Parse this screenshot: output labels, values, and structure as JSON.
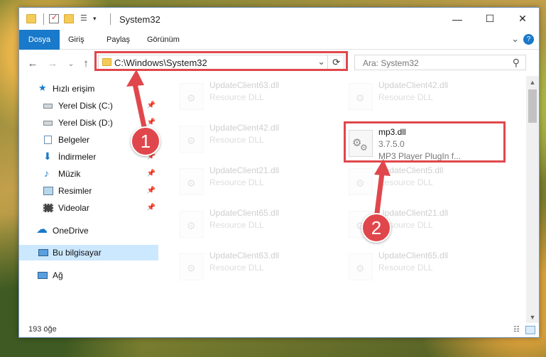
{
  "window": {
    "title": "System32",
    "quick_access_toolbar": [
      "folder-icon",
      "properties-icon",
      "new-folder-icon",
      "customize-icon",
      "dropdown-icon"
    ],
    "controls": {
      "minimize": "—",
      "maximize": "☐",
      "close": "✕"
    }
  },
  "ribbon": {
    "tabs": [
      "Dosya",
      "Giriş",
      "Paylaş",
      "Görünüm"
    ],
    "active_tab": "Dosya",
    "collapse_icon": "⌄",
    "help_icon": "?"
  },
  "navigation": {
    "back": "←",
    "forward": "→",
    "recent": "⌄",
    "up": "↑",
    "address": "C:\\Windows\\System32",
    "address_dropdown": "⌄",
    "refresh": "⟳",
    "search_placeholder": "Ara: System32",
    "search_icon": "⚲"
  },
  "sidebar": {
    "quick_access": "Hızlı erişim",
    "items": [
      {
        "label": "Yerel Disk (C:)",
        "icon": "drive-icon",
        "pinned": true
      },
      {
        "label": "Yerel Disk (D:)",
        "icon": "drive-icon",
        "pinned": true
      },
      {
        "label": "Belgeler",
        "icon": "documents-icon",
        "pinned": true
      },
      {
        "label": "İndirmeler",
        "icon": "downloads-icon",
        "pinned": true
      },
      {
        "label": "Müzik",
        "icon": "music-icon",
        "pinned": true
      },
      {
        "label": "Resimler",
        "icon": "pictures-icon",
        "pinned": true
      },
      {
        "label": "Videolar",
        "icon": "videos-icon",
        "pinned": true
      }
    ],
    "onedrive": "OneDrive",
    "this_pc": "Bu bilgisayar",
    "network": "Ağ",
    "pin_glyph": "📌"
  },
  "files": {
    "left_column": [
      {
        "name": "UpdateClient63.dll",
        "desc": "Resource DLL"
      },
      {
        "name": "UpdateClient42.dll",
        "desc": "Resource DLL"
      },
      {
        "name": "UpdateClient21.dll",
        "desc": "Resource DLL"
      },
      {
        "name": "UpdateClient65.dll",
        "desc": "Resource DLL"
      },
      {
        "name": "UpdateClient63.dll",
        "desc": "Resource DLL"
      }
    ],
    "right_column": [
      {
        "name": "UpdateClient42.dll",
        "desc": "Resource DLL"
      },
      {
        "name": "UpdateClient5.dll",
        "desc": "Resource DLL"
      },
      {
        "name": "UpdateClient21.dll",
        "desc": "Resource DLL"
      },
      {
        "name": "UpdateClient65.dll",
        "desc": "Resource DLL"
      }
    ],
    "highlighted": {
      "name": "mp3.dll",
      "version": "3.7.5.0",
      "desc": "MP3 Player PlugIn f..."
    }
  },
  "status": {
    "item_count": "193 öğe"
  },
  "annotations": {
    "marker1": "1",
    "marker2": "2",
    "color": "#e0474c"
  },
  "colors": {
    "accent": "#1979ca",
    "selection": "#cce8ff",
    "highlight": "#e0474c"
  }
}
